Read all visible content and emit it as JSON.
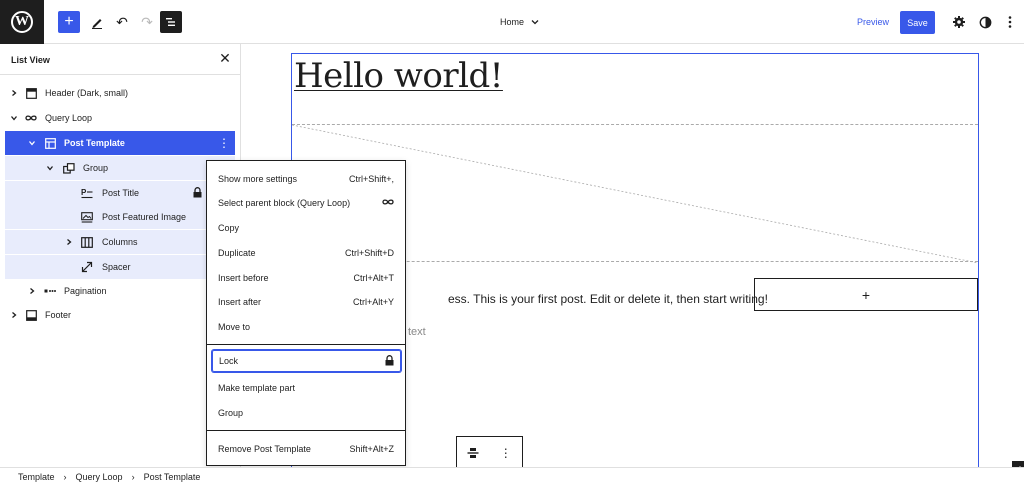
{
  "toolbar": {
    "logo_letter": "W",
    "add_label": "+",
    "undo_glyph": "↶",
    "redo_glyph": "↷",
    "document_title": "Home",
    "preview_label": "Preview",
    "save_label": "Save"
  },
  "sidebar": {
    "title": "List View",
    "close_glyph": "✕",
    "items": [
      {
        "label": "Header (Dark, small)",
        "icon": "template-part-icon",
        "expanded": false
      },
      {
        "label": "Query Loop",
        "icon": "loop-icon",
        "expanded": true
      },
      {
        "label": "Post Template",
        "icon": "layout-icon",
        "expanded": true,
        "selected": true,
        "more": "⋮"
      },
      {
        "label": "Group",
        "icon": "group-icon",
        "expanded": true
      },
      {
        "label": "Post Title",
        "icon": "title-icon",
        "locked": true
      },
      {
        "label": "Post Featured Image",
        "icon": "image-icon"
      },
      {
        "label": "Columns",
        "icon": "columns-icon",
        "expanded": false
      },
      {
        "label": "Spacer",
        "icon": "resize-icon"
      },
      {
        "label": "Pagination",
        "icon": "pagination-icon",
        "expanded": false
      },
      {
        "label": "Footer",
        "icon": "footer-icon",
        "expanded": false
      }
    ]
  },
  "canvas": {
    "post_title": "Hello world!",
    "post_text": "ess. This is your first post. Edit or delete it, then start writing!",
    "excerpt_placeholder": "text",
    "appender_glyph": "+",
    "toolbar_more": "⋮",
    "corner_add": "+"
  },
  "context_menu": {
    "items": [
      {
        "label": "Show more settings",
        "shortcut": "Ctrl+Shift+,"
      },
      {
        "label": "Select parent block (Query Loop)",
        "shortcut_icon": "loop-icon"
      },
      {
        "label": "Copy",
        "shortcut": ""
      },
      {
        "label": "Duplicate",
        "shortcut": "Ctrl+Shift+D"
      },
      {
        "label": "Insert before",
        "shortcut": "Ctrl+Alt+T"
      },
      {
        "label": "Insert after",
        "shortcut": "Ctrl+Alt+Y"
      },
      {
        "label": "Move to",
        "shortcut": ""
      },
      {
        "label": "Lock",
        "shortcut_icon": "lock-icon",
        "focused": true
      },
      {
        "label": "Make template part",
        "shortcut": ""
      },
      {
        "label": "Group",
        "shortcut": ""
      },
      {
        "label": "Remove Post Template",
        "shortcut": "Shift+Alt+Z"
      }
    ]
  },
  "breadcrumb": {
    "items": [
      "Template",
      "Query Loop",
      "Post Template"
    ],
    "separator": "›"
  },
  "colors": {
    "accent": "#3858e9",
    "dark": "#1e1e1e",
    "selection_tint": "#e8ecfc"
  }
}
